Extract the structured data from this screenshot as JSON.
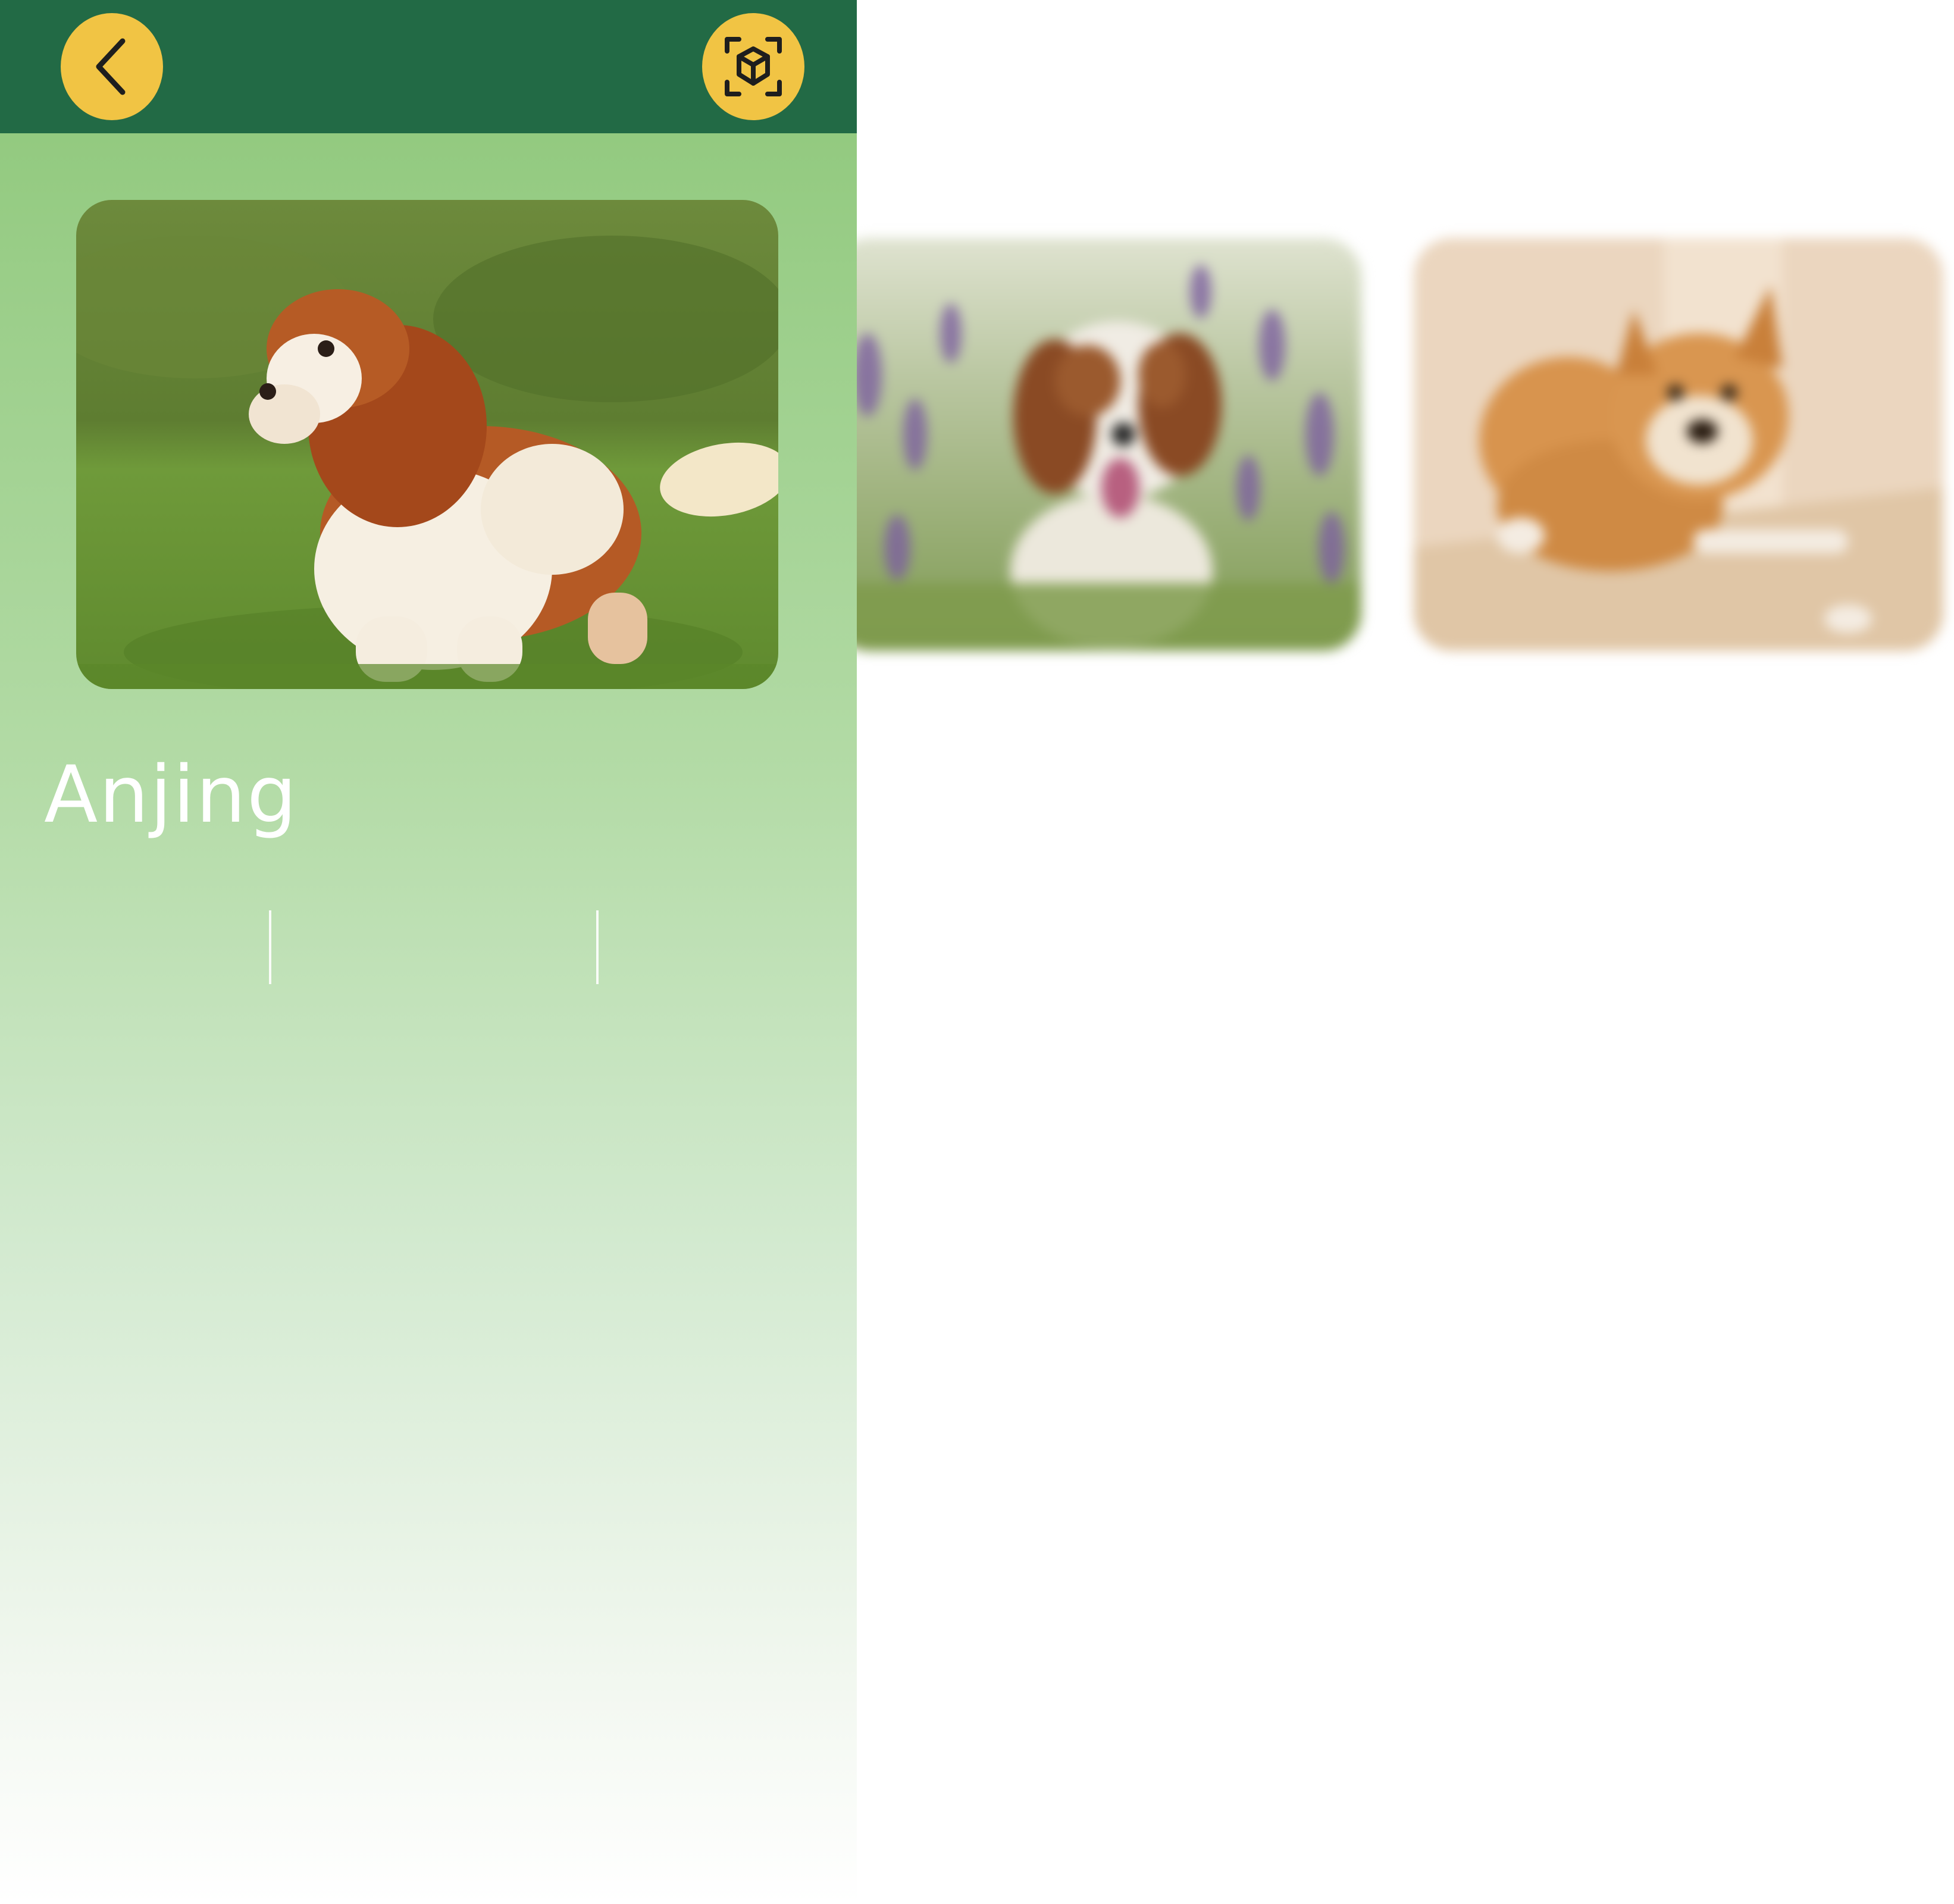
{
  "header": {
    "back_icon": "chevron-left-icon",
    "ar_icon": "ar-cube-scan-icon",
    "button_color": "#f1c444",
    "bar_color": "#226a45"
  },
  "main": {
    "title": "Anjing",
    "hero_image": "cavalier-king-charles-spaniel-on-grass",
    "background_color": "#93ca80"
  },
  "gallery": {
    "images": [
      "brown-white-dog-in-lavender-field",
      "shiba-inu-lying-on-wooden-floor"
    ]
  }
}
